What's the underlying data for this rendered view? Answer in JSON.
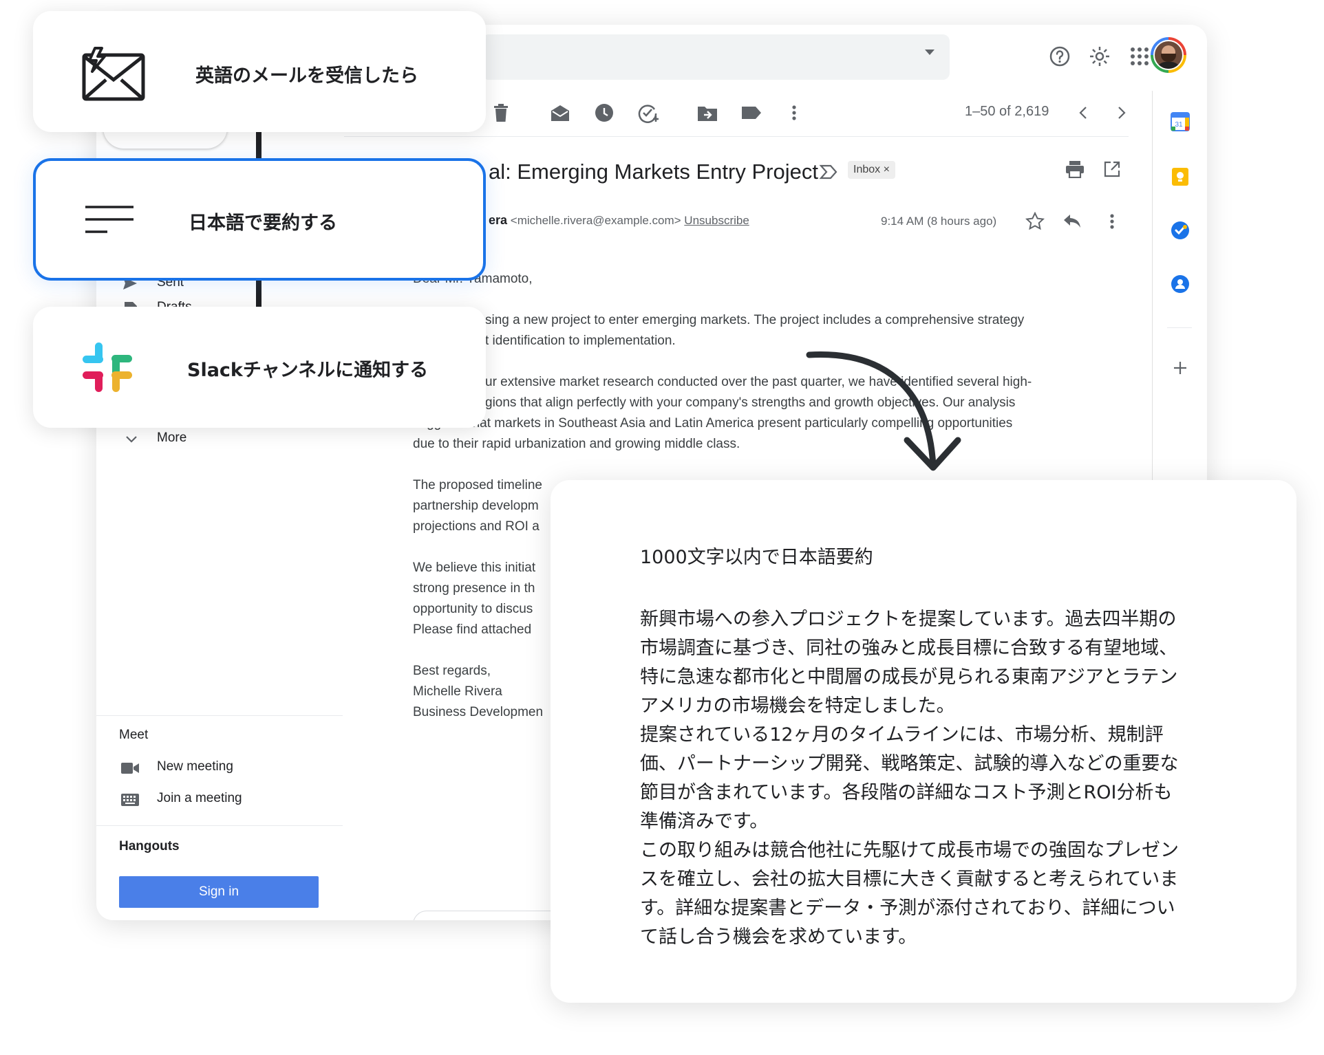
{
  "trigger_card": {
    "title": "英語のメールを受信したら"
  },
  "summarize_card": {
    "title": "日本語で要約する"
  },
  "slack_card": {
    "title": "Slackチャンネルに通知する"
  },
  "gmail": {
    "pager": "1–50 of 2,619",
    "subject": "al: Emerging Markets Entry Project",
    "inbox_chip": "Inbox ×",
    "sender_name": "era",
    "sender_email": "<michelle.rivera@example.com>",
    "unsubscribe": "Unsubscribe",
    "time": "9:14 AM (8 hours ago)",
    "calendar_date": "31",
    "body_lines_top": [
      "Dear Mr. Yamamoto,",
      "",
      "sing a new project to enter emerging markets. The project includes a comprehensive strategy",
      "t identification to implementation.",
      "",
      "ur extensive market research conducted over the past quarter, we have identified several high-",
      "gions that align perfectly with your company's strengths and growth objectives. Our analysis",
      "suggests that markets in Southeast Asia and Latin America present particularly compelling opportunities",
      "due to their rapid urbanization and growing middle class."
    ],
    "body_lines_bottom": [
      "The proposed timeline",
      "partnership developm",
      "projections and ROI a",
      "",
      "We believe this initiat",
      "strong presence in th",
      "opportunity to discus",
      "Please find attached",
      "",
      "Best regards,",
      "Michelle Rivera",
      "Business Developmen"
    ],
    "sidebar": {
      "sent": "Sent",
      "drafts": "Drafts",
      "more": "More",
      "meet_title": "Meet",
      "new_meeting": "New meeting",
      "join_meeting": "Join a meeting",
      "hangouts_title": "Hangouts",
      "sign_in": "Sign in"
    }
  },
  "summary": {
    "title": "1000文字以内で日本語要約",
    "lines": [
      "新興市場への参入プロジェクトを提案しています。過去四半期の",
      "市場調査に基づき、同社の強みと成長目標に合致する有望地域、",
      "特に急速な都市化と中間層の成長が見られる東南アジアとラテン",
      "アメリカの市場機会を特定しました。",
      "提案されている12ヶ月のタイムラインには、市場分析、規制評",
      "価、パートナーシップ開発、戦略策定、試験的導入などの重要な",
      "節目が含まれています。各段階の詳細なコスト予測とROI分析も",
      "準備済みです。",
      "この取り組みは競合他社に先駆けて成長市場での強固なプレゼン",
      "スを確立し、会社の拡大目標に大きく貢献すると考えられていま",
      "す。詳細な提案書とデータ・予測が添付されており、詳細につい",
      "て話し合う機会を求めています。"
    ]
  },
  "colors": {
    "accent": "#1a73e8",
    "signin": "#4a7fe8",
    "arrow": "#2b2f33"
  }
}
